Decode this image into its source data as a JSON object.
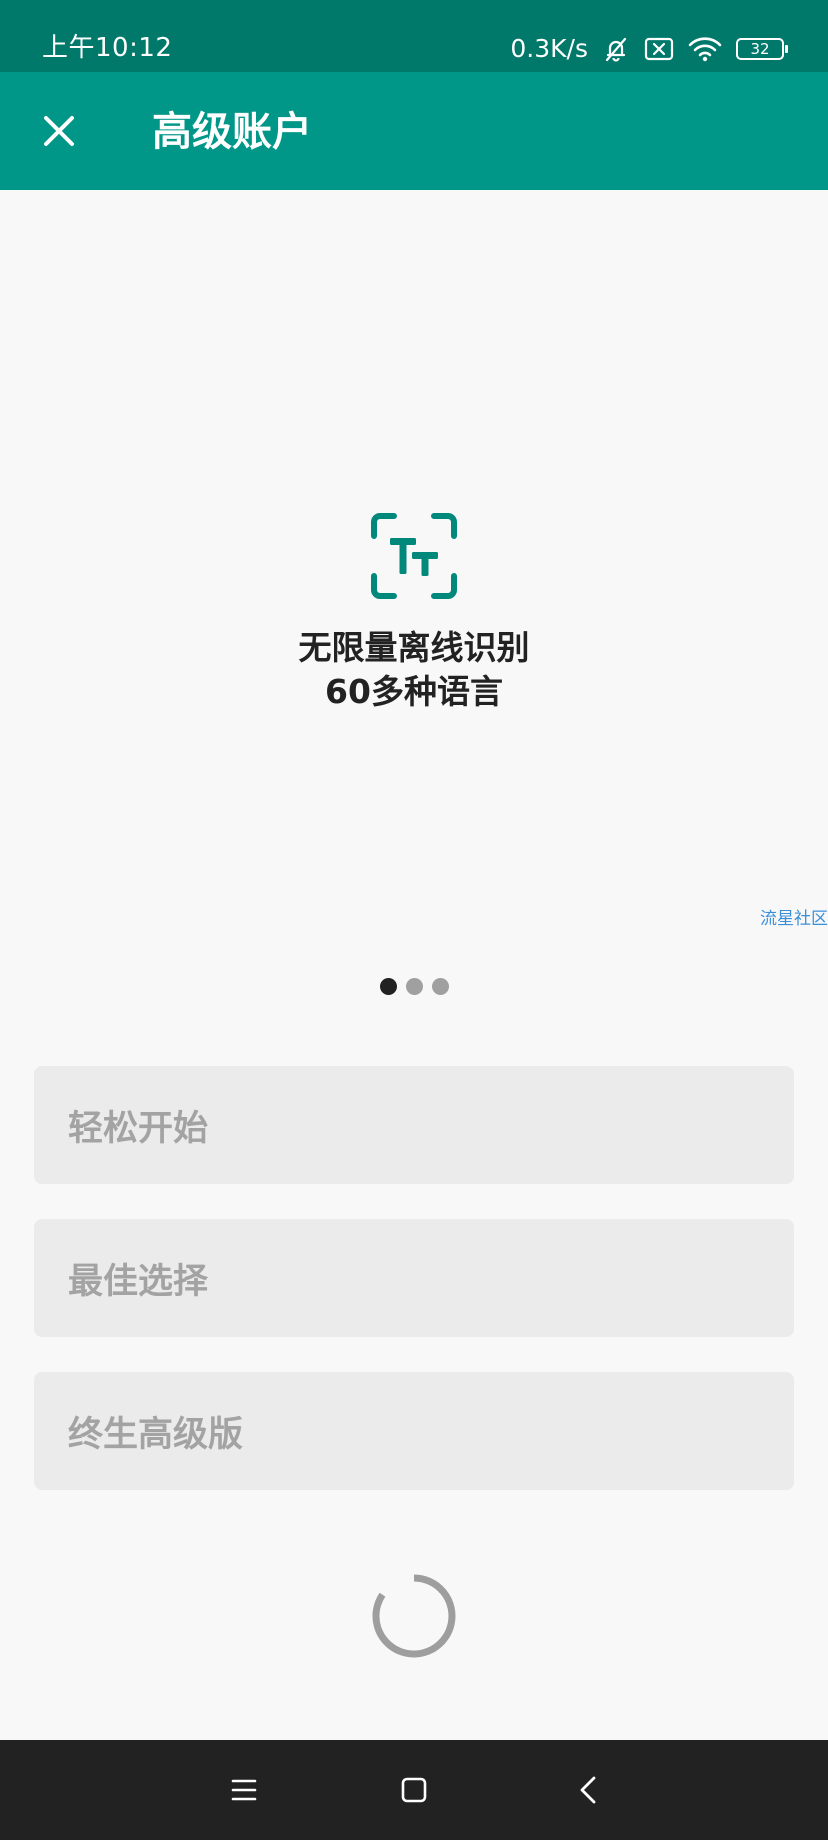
{
  "status_bar": {
    "time": "上午10:12",
    "net_speed": "0.3K/s",
    "battery_level": "32",
    "icons": [
      "bell-off-icon",
      "notification-close-icon",
      "wifi-icon",
      "battery-icon"
    ]
  },
  "app_bar": {
    "close_icon": "close-icon",
    "title": "高级账户"
  },
  "feature": {
    "icon": "text-scan-icon",
    "line1": "无限量离线识别",
    "line2": "60多种语言"
  },
  "watermark": "流星社区",
  "pager": {
    "count": 3,
    "active_index": 0
  },
  "options": [
    {
      "label": "轻松开始"
    },
    {
      "label": "最佳选择"
    },
    {
      "label": "终生高级版"
    }
  ],
  "loading": {
    "icon": "loading-spinner-icon"
  },
  "nav_bar": {
    "icons": [
      "menu-icon",
      "home-icon",
      "back-icon"
    ]
  },
  "colors": {
    "status_bar": "#00796b",
    "app_bar": "#009688",
    "accent": "#00897b",
    "background": "#f8f8f8",
    "option_bg": "#ebebeb",
    "option_text": "#a3a3a3",
    "nav_bar": "#222222"
  }
}
